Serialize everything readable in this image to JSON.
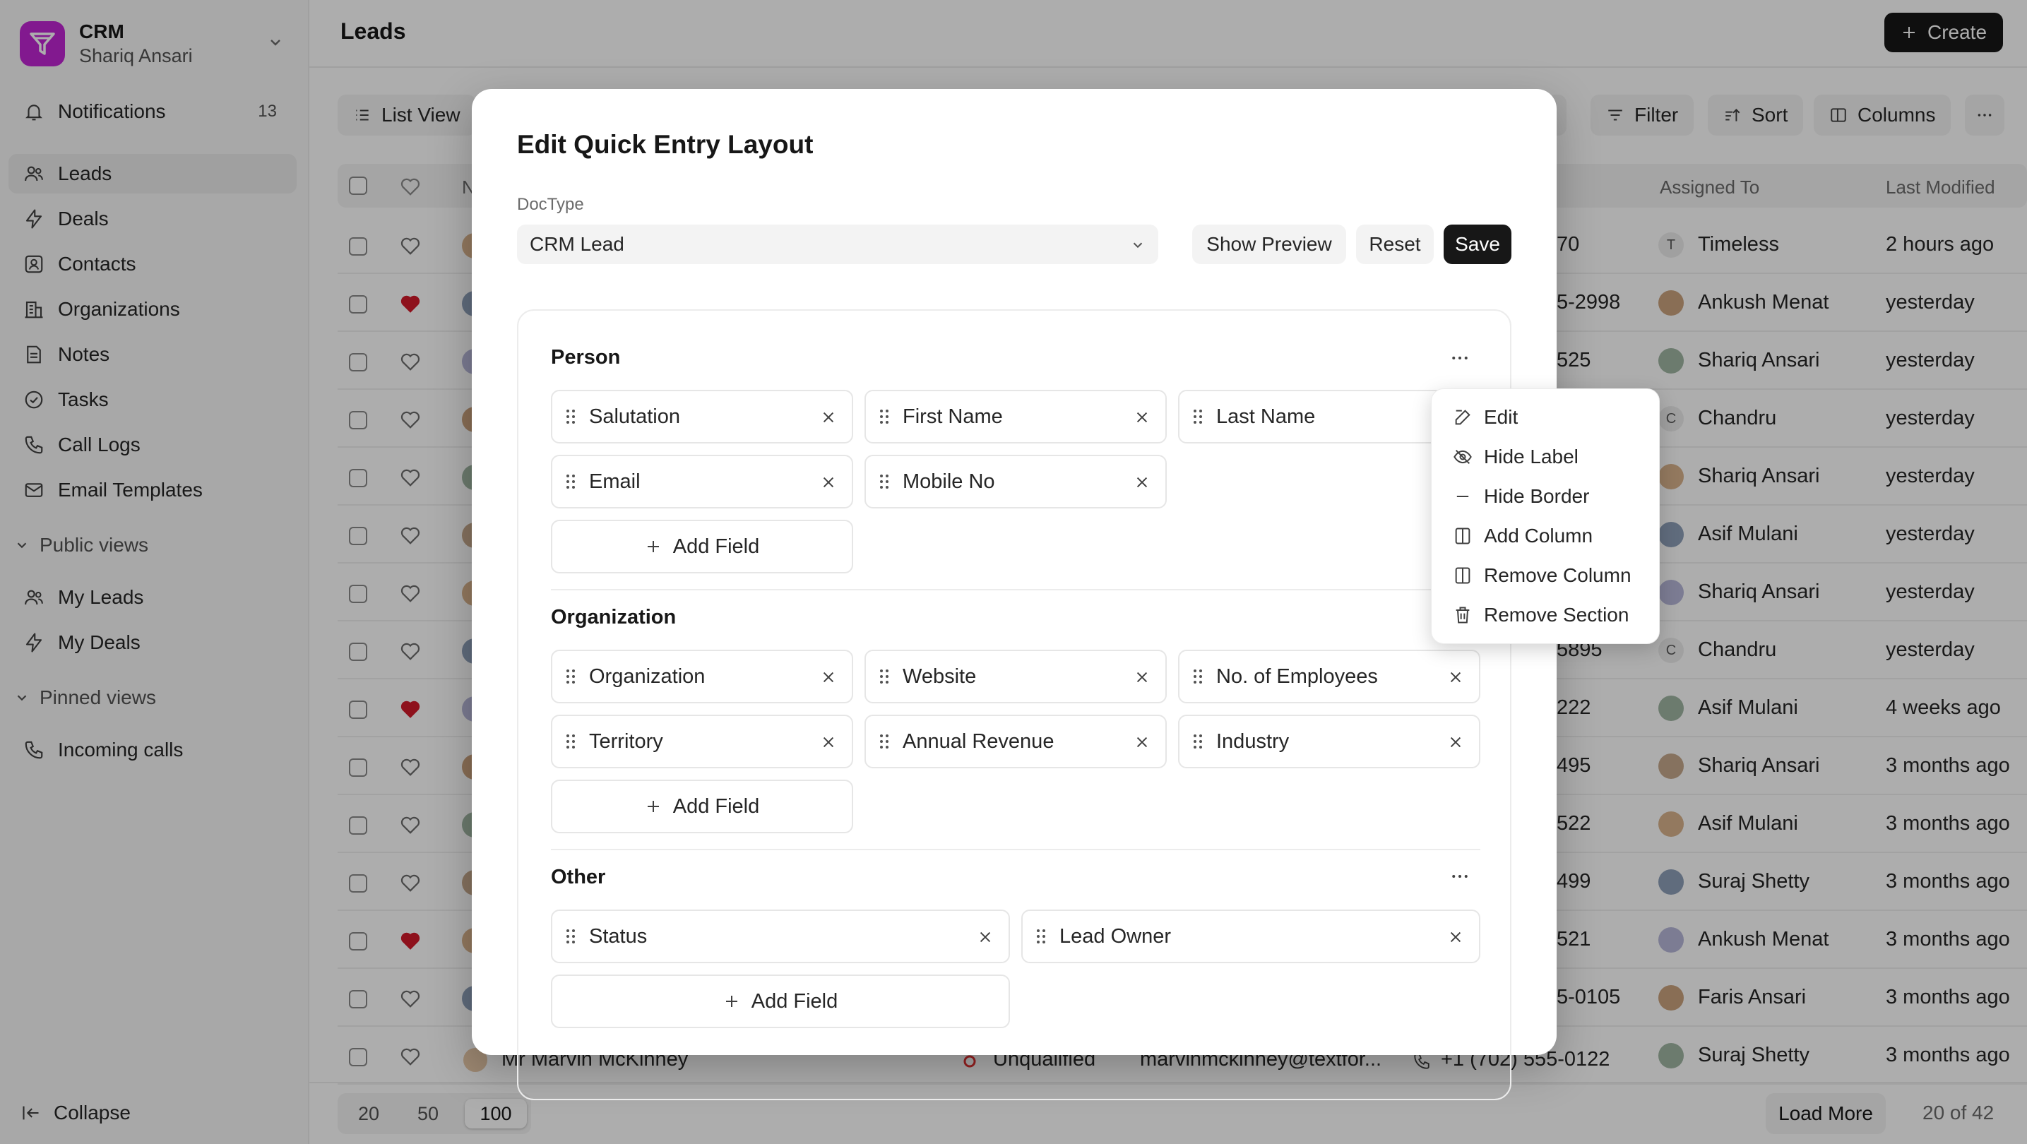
{
  "app": {
    "name": "CRM",
    "user": "Shariq Ansari"
  },
  "sidebar": {
    "notifications": {
      "label": "Notifications",
      "count": "13"
    },
    "items": [
      {
        "label": "Leads",
        "icon": "users-icon"
      },
      {
        "label": "Deals",
        "icon": "lightning-icon"
      },
      {
        "label": "Contacts",
        "icon": "contact-card-icon"
      },
      {
        "label": "Organizations",
        "icon": "building-icon"
      },
      {
        "label": "Notes",
        "icon": "note-icon"
      },
      {
        "label": "Tasks",
        "icon": "check-circle-icon"
      },
      {
        "label": "Call Logs",
        "icon": "phone-icon"
      },
      {
        "label": "Email Templates",
        "icon": "mail-icon"
      }
    ],
    "public_views": {
      "label": "Public views",
      "items": [
        {
          "label": "My Leads"
        },
        {
          "label": "My Deals"
        }
      ]
    },
    "pinned_views": {
      "label": "Pinned views",
      "items": [
        {
          "label": "Incoming calls"
        }
      ]
    },
    "collapse": "Collapse"
  },
  "header": {
    "title": "Leads",
    "create": "Create"
  },
  "toolbar": {
    "view": "List View",
    "filter": "Filter",
    "sort": "Sort",
    "columns": "Columns"
  },
  "table": {
    "columns": [
      "N",
      "Assigned To",
      "Last Modified"
    ],
    "rows": [
      {
        "fav": false,
        "phone": "70",
        "assigned": "Timeless",
        "assigned_initial": "T",
        "modified": "2 hours ago"
      },
      {
        "fav": true,
        "phone": "5-2998",
        "assigned": "Ankush Menat",
        "modified": "yesterday"
      },
      {
        "fav": false,
        "phone": "525",
        "assigned": "Shariq Ansari",
        "modified": "yesterday"
      },
      {
        "fav": false,
        "phone": "",
        "assigned": "Chandru",
        "assigned_initial": "C",
        "modified": "yesterday"
      },
      {
        "fav": false,
        "phone": "",
        "assigned": "Shariq Ansari",
        "modified": "yesterday"
      },
      {
        "fav": false,
        "phone": "",
        "assigned": "Asif Mulani",
        "modified": "yesterday"
      },
      {
        "fav": false,
        "phone": "",
        "assigned": "Shariq Ansari",
        "modified": "yesterday"
      },
      {
        "fav": false,
        "phone": "5895",
        "assigned": "Chandru",
        "assigned_initial": "C",
        "modified": "yesterday"
      },
      {
        "fav": true,
        "phone": "222",
        "assigned": "Asif Mulani",
        "modified": "4 weeks ago"
      },
      {
        "fav": false,
        "phone": "495",
        "assigned": "Shariq Ansari",
        "modified": "3 months ago"
      },
      {
        "fav": false,
        "phone": "522",
        "assigned": "Asif Mulani",
        "modified": "3 months ago"
      },
      {
        "fav": false,
        "phone": "499",
        "assigned": "Suraj Shetty",
        "modified": "3 months ago"
      },
      {
        "fav": true,
        "phone": "521",
        "assigned": "Ankush Menat",
        "modified": "3 months ago"
      },
      {
        "fav": false,
        "phone": "5-0105",
        "assigned": "Faris Ansari",
        "modified": "3 months ago"
      },
      {
        "fav": false,
        "name": "Mr Marvin McKinney",
        "status": "Unqualified",
        "email": "marvinmckinney@textfor...",
        "phone": "+1 (702) 555-0122",
        "assigned": "Suraj Shetty",
        "modified": "3 months ago"
      }
    ]
  },
  "footer": {
    "page_sizes": [
      "20",
      "50",
      "100"
    ],
    "selected_page_size": "100",
    "load_more": "Load More",
    "count": "20 of 42"
  },
  "modal": {
    "title": "Edit Quick Entry Layout",
    "doctype_label": "DocType",
    "doctype_value": "CRM Lead",
    "show_preview": "Show Preview",
    "reset": "Reset",
    "save": "Save",
    "add_field": "Add Field",
    "sections": [
      {
        "title": "Person",
        "fields": [
          "Salutation",
          "First Name",
          "Last Name",
          "Email",
          "Mobile No"
        ]
      },
      {
        "title": "Organization",
        "fields": [
          "Organization",
          "Website",
          "No. of Employees",
          "Territory",
          "Annual Revenue",
          "Industry"
        ]
      },
      {
        "title": "Other",
        "fields": [
          "Status",
          "Lead Owner"
        ]
      }
    ]
  },
  "section_menu": {
    "items": [
      {
        "label": "Edit",
        "icon": "edit-icon"
      },
      {
        "label": "Hide Label",
        "icon": "eye-off-icon"
      },
      {
        "label": "Hide Border",
        "icon": "minus-icon"
      },
      {
        "label": "Add Column",
        "icon": "column-icon"
      },
      {
        "label": "Remove Column",
        "icon": "column-icon"
      },
      {
        "label": "Remove Section",
        "icon": "trash-icon"
      }
    ]
  },
  "colors": {
    "brand": "#c026d3",
    "primary": "#171717",
    "heart": "#d11a2a",
    "overlay": "rgba(0,0,0,0.32)"
  }
}
